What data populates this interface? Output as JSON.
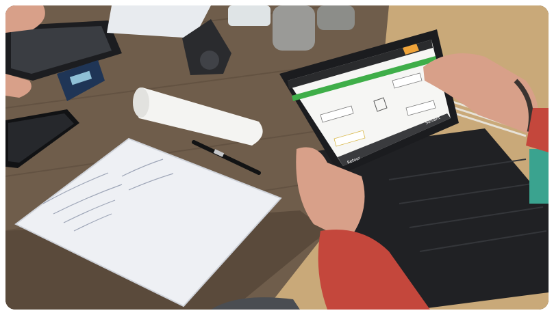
{
  "photo": {
    "description_free": true,
    "colors": {
      "table": "#6f5d4b",
      "table_dark": "#4d4033",
      "floor": "#c9a979",
      "notebook": "#eef0f4",
      "tablet_bezel": "#1b1c1f",
      "case": "#202124",
      "sweater": "#c4473c",
      "skin": "#d8a089",
      "app_green": "#3fae49",
      "app_orange": "#f0a43a"
    }
  },
  "tablet_app": {
    "header_left": "",
    "back_label": "Retour",
    "next_label": "Suivant"
  }
}
